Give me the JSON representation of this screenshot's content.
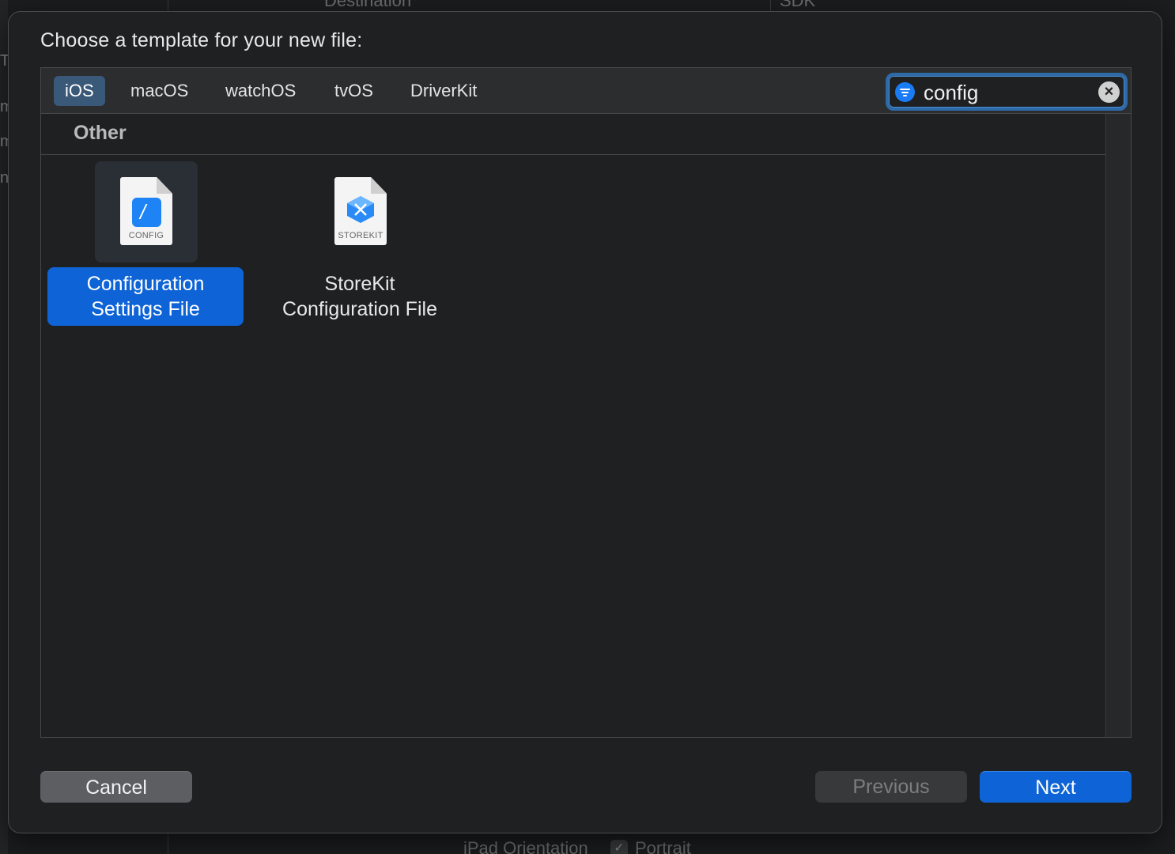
{
  "background": {
    "top_labels": [
      "Destination",
      "SDK"
    ],
    "bottom_labels": [
      "iPad Orientation",
      "Portrait"
    ],
    "left_glyphs": [
      "T",
      "m",
      "m",
      "n"
    ]
  },
  "dialog": {
    "title": "Choose a template for your new file:"
  },
  "platform_tabs": [
    {
      "label": "iOS",
      "selected": true
    },
    {
      "label": "macOS",
      "selected": false
    },
    {
      "label": "watchOS",
      "selected": false
    },
    {
      "label": "tvOS",
      "selected": false
    },
    {
      "label": "DriverKit",
      "selected": false
    }
  ],
  "search": {
    "value": "config",
    "icon": "filter-icon",
    "clear_icon": "clear-icon"
  },
  "section": {
    "title": "Other"
  },
  "templates": [
    {
      "label_line1": "Configuration",
      "label_line2": "Settings File",
      "icon_caption": "CONFIG",
      "icon": "config-file-icon",
      "selected": true
    },
    {
      "label_line1": "StoreKit",
      "label_line2": "Configuration File",
      "icon_caption": "STOREKIT",
      "icon": "storekit-file-icon",
      "selected": false
    }
  ],
  "buttons": {
    "cancel": "Cancel",
    "previous": "Previous",
    "next": "Next"
  },
  "colors": {
    "accent": "#0e64d6",
    "sheet_bg": "#1e2022",
    "tab_selected_bg": "#3a5878"
  }
}
